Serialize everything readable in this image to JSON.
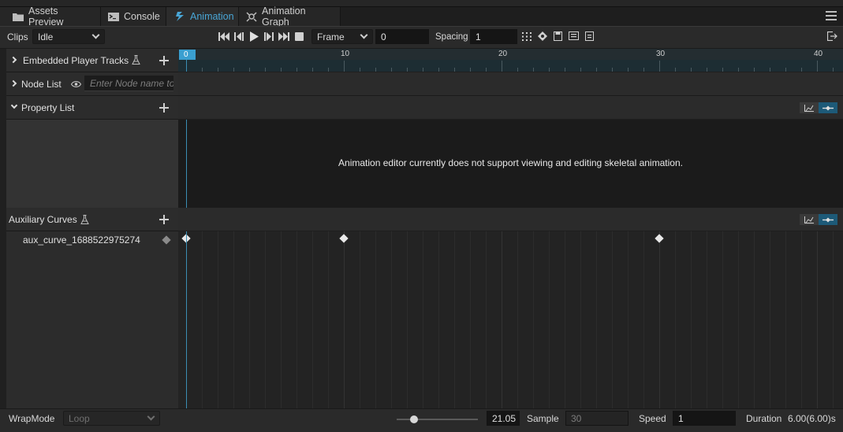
{
  "tabs": [
    {
      "label": "Assets Preview",
      "icon": "folder-icon",
      "active": false
    },
    {
      "label": "Console",
      "icon": "console-icon",
      "active": false
    },
    {
      "label": "Animation",
      "icon": "animation-icon",
      "active": true
    },
    {
      "label": "Animation Graph",
      "icon": "graph-icon",
      "active": false
    }
  ],
  "toolbar": {
    "clips_label": "Clips",
    "clip_value": "Idle",
    "unit_value": "Frame",
    "frame_value": "0",
    "spacing_label": "Spacing",
    "spacing_value": "1"
  },
  "left": {
    "embedded_label": "Embedded Player Tracks",
    "nodelist_label": "Node List",
    "node_placeholder": "Enter Node name to search",
    "property_label": "Property List",
    "auxiliary_label": "Auxiliary Curves",
    "curve_name": "aux_curve_1688522975274"
  },
  "ruler": {
    "ticks": [
      "0",
      "10",
      "20",
      "30",
      "40"
    ],
    "current": "0"
  },
  "message": "Animation editor currently does not support viewing and editing skeletal animation.",
  "keyframes": [
    0,
    10,
    30
  ],
  "bottom": {
    "wrapmode_label": "WrapMode",
    "wrapmode_value": "Loop",
    "time_value": "21.05",
    "sample_label": "Sample",
    "sample_value": "30",
    "speed_label": "Speed",
    "speed_value": "1",
    "duration_label": "Duration",
    "duration_value": "6.00(6.00)s"
  },
  "colors": {
    "accent": "#49a6d6",
    "cursor": "#3b8eb4",
    "toggle_active": "#1d5a78"
  }
}
